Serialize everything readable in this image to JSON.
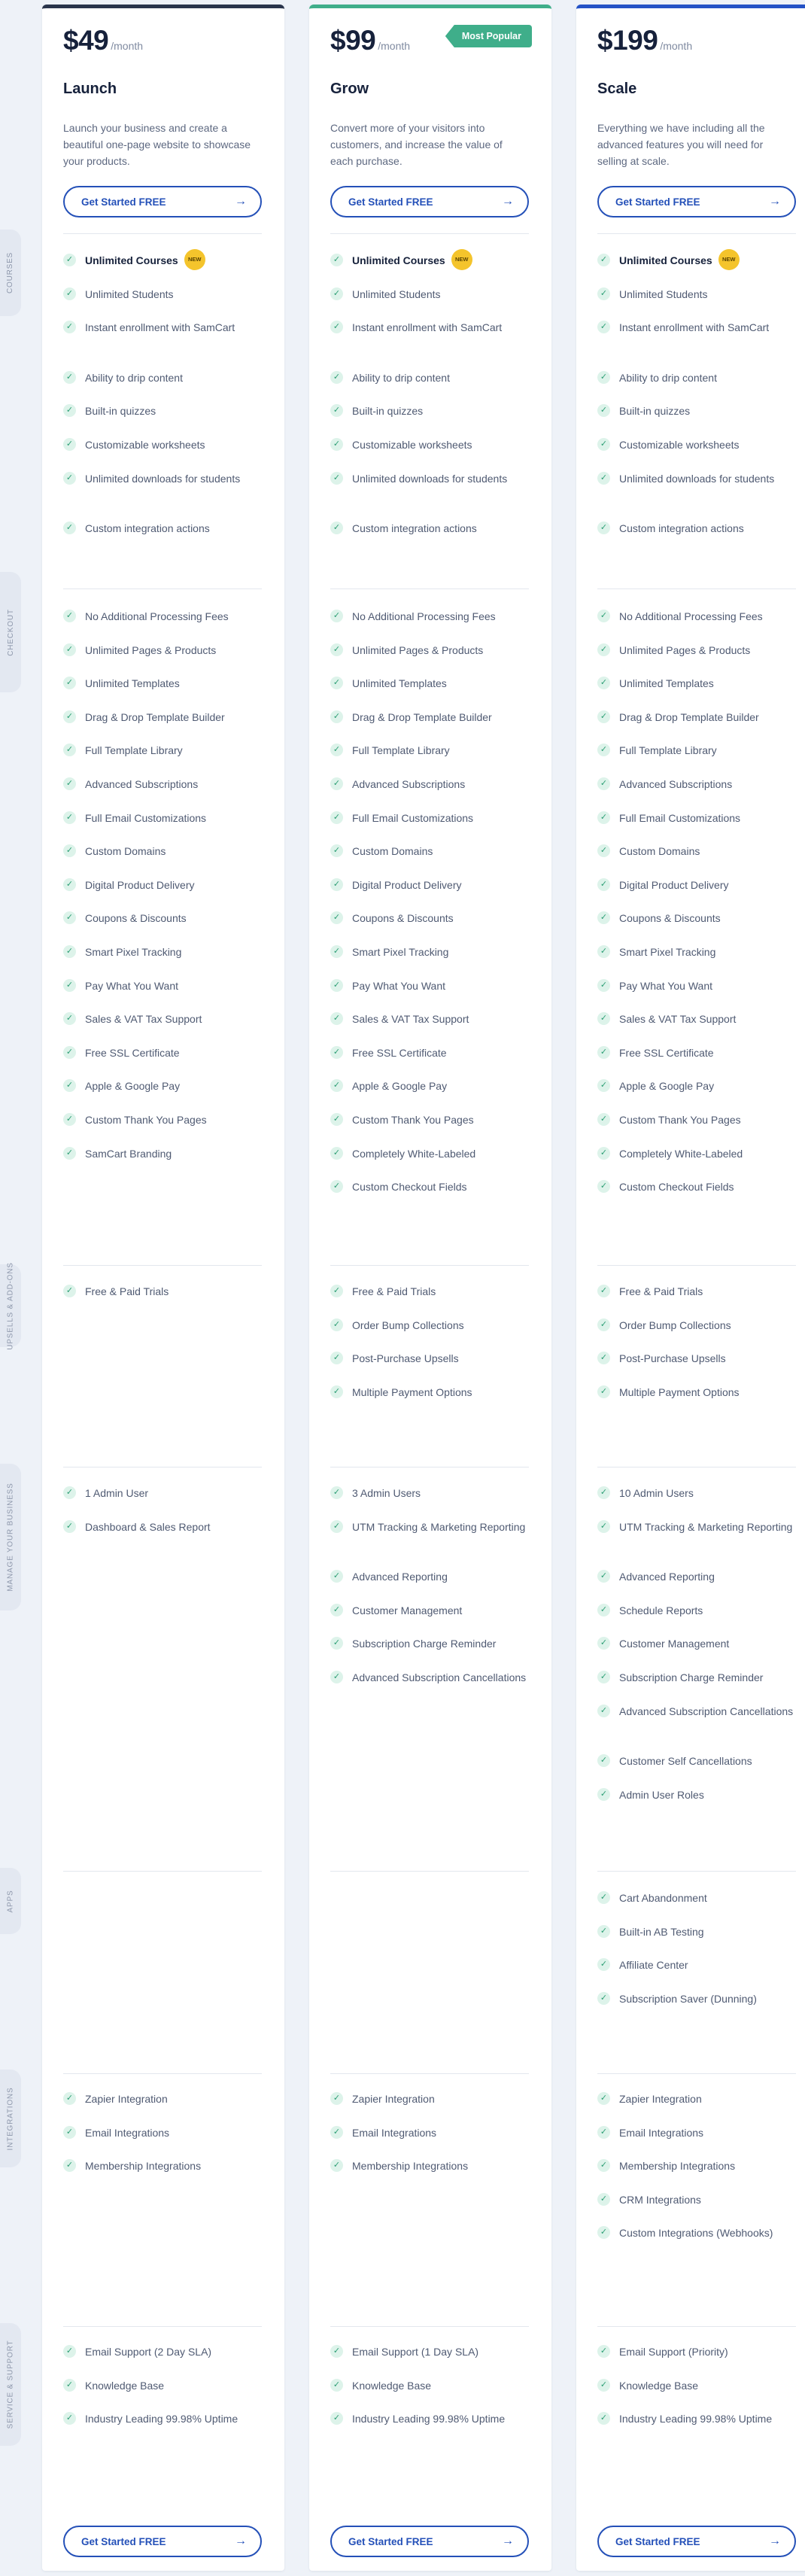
{
  "sections": [
    {
      "key": "courses",
      "label": "Courses"
    },
    {
      "key": "checkout",
      "label": "Checkout"
    },
    {
      "key": "upsells",
      "label": "Upsells & Add-ons"
    },
    {
      "key": "manage",
      "label": "Manage Your Business"
    },
    {
      "key": "apps",
      "label": "Apps"
    },
    {
      "key": "integrations",
      "label": "Integrations"
    },
    {
      "key": "support",
      "label": "Service & Support"
    }
  ],
  "new_badge": "NEW",
  "plans": [
    {
      "key": "launch",
      "price": "$49",
      "period": "/month",
      "name": "Launch",
      "badge": "",
      "description": "Launch your business and create a beautiful one-page website to showcase your products.",
      "cta": "Get Started FREE",
      "accent": "#29344b",
      "courses": [
        "Unlimited Courses",
        "Unlimited Students",
        "Instant enrollment with SamCart",
        "Ability to drip content",
        "Built-in quizzes",
        "Customizable worksheets",
        "Unlimited downloads for students",
        "Custom integration actions"
      ],
      "checkout": [
        "No Additional Processing Fees",
        "Unlimited Pages & Products",
        "Unlimited Templates",
        "Drag & Drop Template Builder",
        "Full Template Library",
        "Advanced Subscriptions",
        "Full Email Customizations",
        "Custom Domains",
        "Digital Product Delivery",
        "Coupons & Discounts",
        "Smart Pixel Tracking",
        "Pay What You Want",
        "Sales & VAT Tax Support",
        "Free SSL Certificate",
        "Apple & Google Pay",
        "Custom Thank You Pages",
        "SamCart Branding"
      ],
      "upsells": [
        "Free & Paid Trials"
      ],
      "manage": [
        "1 Admin User",
        "Dashboard & Sales Report"
      ],
      "apps": [],
      "integrations": [
        "Zapier Integration",
        "Email Integrations",
        "Membership Integrations"
      ],
      "support": [
        "Email Support (2 Day SLA)",
        "Knowledge Base",
        "Industry Leading 99.98% Uptime"
      ]
    },
    {
      "key": "grow",
      "price": "$99",
      "period": "/month",
      "name": "Grow",
      "badge": "Most Popular",
      "description": "Convert more of your visitors into customers, and increase the value of each purchase.",
      "cta": "Get Started FREE",
      "accent": "#3fae8a",
      "courses": [
        "Unlimited Courses",
        "Unlimited Students",
        "Instant enrollment with SamCart",
        "Ability to drip content",
        "Built-in quizzes",
        "Customizable worksheets",
        "Unlimited downloads for students",
        "Custom integration actions"
      ],
      "checkout": [
        "No Additional Processing Fees",
        "Unlimited Pages & Products",
        "Unlimited Templates",
        "Drag & Drop Template Builder",
        "Full Template Library",
        "Advanced Subscriptions",
        "Full Email Customizations",
        "Custom Domains",
        "Digital Product Delivery",
        "Coupons & Discounts",
        "Smart Pixel Tracking",
        "Pay What You Want",
        "Sales & VAT Tax Support",
        "Free SSL Certificate",
        "Apple & Google Pay",
        "Custom Thank You Pages",
        "Completely White-Labeled",
        "Custom Checkout Fields"
      ],
      "upsells": [
        "Free & Paid Trials",
        "Order Bump Collections",
        "Post-Purchase Upsells",
        "Multiple Payment Options"
      ],
      "manage": [
        "3 Admin Users",
        "UTM Tracking & Marketing Reporting",
        "Advanced Reporting",
        "Customer Management",
        "Subscription Charge Reminder",
        "Advanced Subscription Cancellations"
      ],
      "apps": [],
      "integrations": [
        "Zapier Integration",
        "Email Integrations",
        "Membership Integrations"
      ],
      "support": [
        "Email Support (1 Day SLA)",
        "Knowledge Base",
        "Industry Leading 99.98% Uptime"
      ]
    },
    {
      "key": "scale",
      "price": "$199",
      "period": "/month",
      "name": "Scale",
      "badge": "",
      "description": "Everything we have including all the advanced features you will need for selling at scale.",
      "cta": "Get Started FREE",
      "accent": "#2452c6",
      "courses": [
        "Unlimited Courses",
        "Unlimited Students",
        "Instant enrollment with SamCart",
        "Ability to drip content",
        "Built-in quizzes",
        "Customizable worksheets",
        "Unlimited downloads for students",
        "Custom integration actions"
      ],
      "checkout": [
        "No Additional Processing Fees",
        "Unlimited Pages & Products",
        "Unlimited Templates",
        "Drag & Drop Template Builder",
        "Full Template Library",
        "Advanced Subscriptions",
        "Full Email Customizations",
        "Custom Domains",
        "Digital Product Delivery",
        "Coupons & Discounts",
        "Smart Pixel Tracking",
        "Pay What You Want",
        "Sales & VAT Tax Support",
        "Free SSL Certificate",
        "Apple & Google Pay",
        "Custom Thank You Pages",
        "Completely White-Labeled",
        "Custom Checkout Fields"
      ],
      "upsells": [
        "Free & Paid Trials",
        "Order Bump Collections",
        "Post-Purchase Upsells",
        "Multiple Payment Options"
      ],
      "manage": [
        "10 Admin Users",
        "UTM Tracking & Marketing Reporting",
        "Advanced Reporting",
        "Schedule Reports",
        "Customer Management",
        "Subscription Charge Reminder",
        "Advanced Subscription Cancellations",
        "Customer Self Cancellations",
        "Admin User Roles"
      ],
      "apps": [
        "Cart Abandonment",
        "Built-in AB Testing",
        "Affiliate Center",
        "Subscription Saver (Dunning)"
      ],
      "integrations": [
        "Zapier Integration",
        "Email Integrations",
        "Membership Integrations",
        "CRM Integrations",
        "Custom Integrations (Webhooks)"
      ],
      "support": [
        "Email Support (Priority)",
        "Knowledge Base",
        "Industry Leading 99.98% Uptime"
      ]
    }
  ]
}
